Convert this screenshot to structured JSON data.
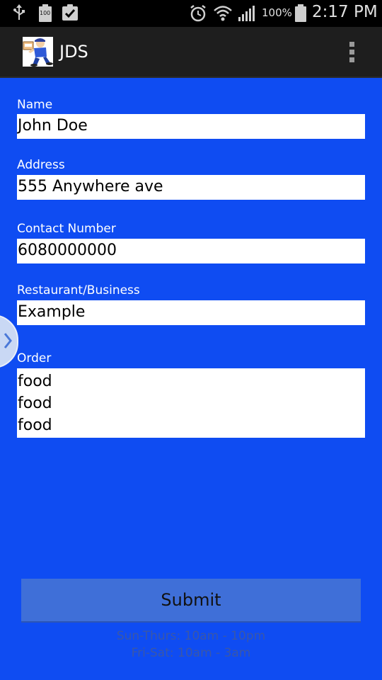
{
  "status_bar": {
    "battery_small": "100",
    "battery_percent": "100%",
    "time": "2:17 PM",
    "icons": [
      "usb-icon",
      "battery-notification-icon",
      "clipboard-check-icon",
      "alarm-icon",
      "wifi-icon",
      "signal-icon",
      "battery-icon"
    ]
  },
  "action_bar": {
    "title": "JDS",
    "logo_text": "LOGO"
  },
  "form": {
    "name_label": "Name",
    "name_value": "John Doe",
    "address_label": "Address",
    "address_value": "555 Anywhere ave",
    "contact_label": "Contact Number",
    "contact_value": "6080000000",
    "business_label": "Restaurant/Business",
    "business_value": "Example",
    "order_label": "Order",
    "order_lines": [
      "food",
      "food",
      "food"
    ]
  },
  "submit_label": "Submit",
  "hours": {
    "weekday": "Sun-Thurs: 10am - 10pm",
    "weekend": "Fri-Sat: 10am - 3am"
  },
  "colors": {
    "background": "#0f4cf2",
    "action_bar": "#1e1e1e",
    "status_bar": "#000000",
    "submit_button": "#3f6fd8",
    "hours_text": "#3a57a8"
  }
}
